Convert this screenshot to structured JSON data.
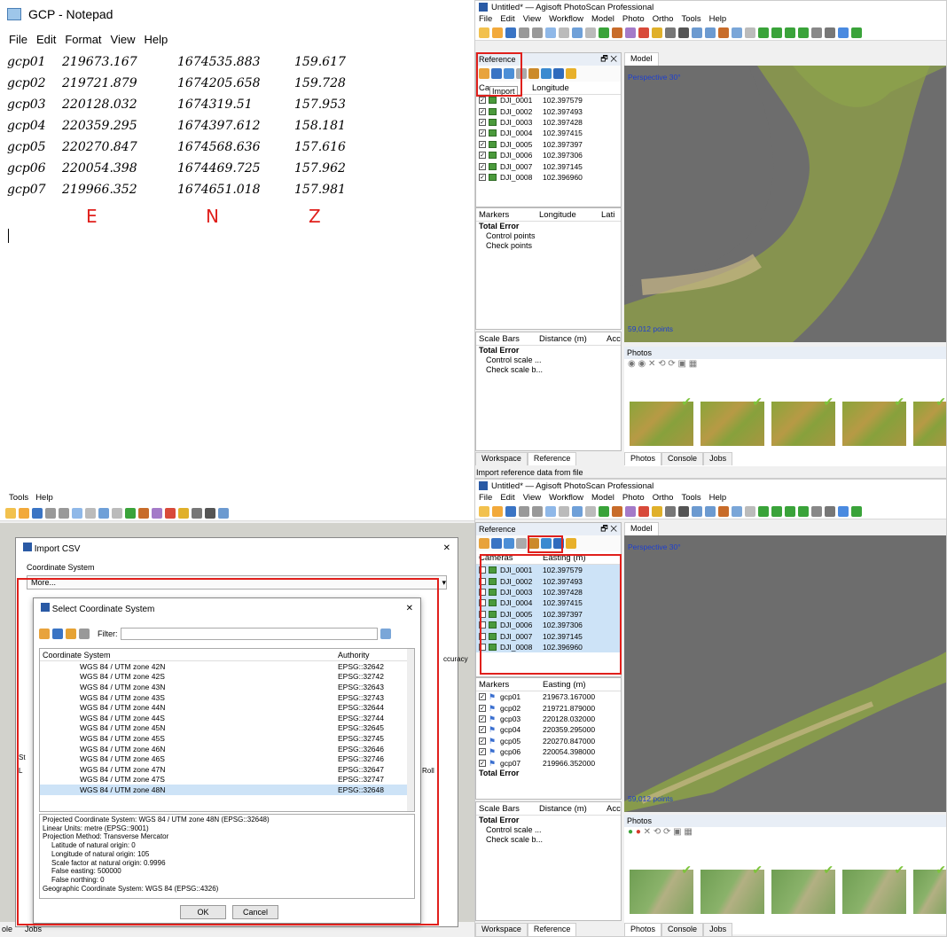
{
  "notepad": {
    "title": "GCP - Notepad",
    "menu": [
      "File",
      "Edit",
      "Format",
      "View",
      "Help"
    ],
    "rows": [
      [
        "gcp01",
        "219673.167",
        "1674535.883",
        "159.617"
      ],
      [
        "gcp02",
        "219721.879",
        "1674205.658",
        "159.728"
      ],
      [
        "gcp03",
        "220128.032",
        "1674319.51",
        "157.953"
      ],
      [
        "gcp04",
        "220359.295",
        "1674397.612",
        "158.181"
      ],
      [
        "gcp05",
        "220270.847",
        "1674568.636",
        "157.616"
      ],
      [
        "gcp06",
        "220054.398",
        "1674469.725",
        "157.962"
      ],
      [
        "gcp07",
        "219966.352",
        "1674651.018",
        "157.981"
      ]
    ],
    "axis_labels": [
      "E",
      "N",
      "Z"
    ]
  },
  "photoscan_top": {
    "title": "Untitled* — Agisoft PhotoScan Professional",
    "menu": [
      "File",
      "Edit",
      "View",
      "Workflow",
      "Model",
      "Photo",
      "Ortho",
      "Tools",
      "Help"
    ],
    "reference_label": "Reference",
    "tooltip": "Import",
    "cameras_col_prefix": "Ca",
    "longitude_col": "Longitude",
    "cameras": [
      [
        "DJI_0001",
        "102.397579"
      ],
      [
        "DJI_0002",
        "102.397493"
      ],
      [
        "DJI_0003",
        "102.397428"
      ],
      [
        "DJI_0004",
        "102.397415"
      ],
      [
        "DJI_0005",
        "102.397397"
      ],
      [
        "DJI_0006",
        "102.397306"
      ],
      [
        "DJI_0007",
        "102.397145"
      ],
      [
        "DJI_0008",
        "102.396960"
      ]
    ],
    "markers_col": "Markers",
    "markers_lon": "Longitude",
    "markers_lat": "Lati",
    "total_error": "Total Error",
    "control_points": "Control points",
    "check_points": "Check points",
    "scalebars_col": "Scale Bars",
    "distance_col": "Distance (m)",
    "acc_col": "Acc",
    "control_scale": "Control scale ...",
    "check_scale": "Check scale b...",
    "model_tab": "Model",
    "perspective": "Perspective 30°",
    "points": "59,012 points",
    "photos_label": "Photos",
    "bottom_tabs_left": [
      "Workspace",
      "Reference"
    ],
    "bottom_tabs_right": [
      "Photos",
      "Console",
      "Jobs"
    ],
    "status": "Import reference data from file"
  },
  "photoscan_bottom": {
    "title": "Untitled* — Agisoft PhotoScan Professional",
    "menu": [
      "File",
      "Edit",
      "View",
      "Workflow",
      "Model",
      "Photo",
      "Ortho",
      "Tools",
      "Help"
    ],
    "reference_label": "Reference",
    "cameras_col": "Cameras",
    "easting_col": "Easting (m)",
    "cameras": [
      [
        "DJI_0001",
        "102.397579"
      ],
      [
        "DJI_0002",
        "102.397493"
      ],
      [
        "DJI_0003",
        "102.397428"
      ],
      [
        "DJI_0004",
        "102.397415"
      ],
      [
        "DJI_0005",
        "102.397397"
      ],
      [
        "DJI_0006",
        "102.397306"
      ],
      [
        "DJI_0007",
        "102.397145"
      ],
      [
        "DJI_0008",
        "102.396960"
      ]
    ],
    "markers_col": "Markers",
    "markers_easting": "Easting (m)",
    "markers": [
      [
        "gcp01",
        "219673.167000"
      ],
      [
        "gcp02",
        "219721.879000"
      ],
      [
        "gcp03",
        "220128.032000"
      ],
      [
        "gcp04",
        "220359.295000"
      ],
      [
        "gcp05",
        "220270.847000"
      ],
      [
        "gcp06",
        "220054.398000"
      ],
      [
        "gcp07",
        "219966.352000"
      ]
    ],
    "total_error": "Total Error",
    "scalebars_col": "Scale Bars",
    "distance_col": "Distance (m)",
    "acc_col": "Acc",
    "control_scale": "Control scale ...",
    "check_scale": "Check scale b...",
    "model_tab": "Model",
    "perspective": "Perspective 30°",
    "points": "59,012 points",
    "photos_label": "Photos",
    "bottom_tabs_left": [
      "Workspace",
      "Reference"
    ],
    "bottom_tabs_right": [
      "Photos",
      "Console",
      "Jobs"
    ]
  },
  "import_csv": {
    "menu": [
      "Tools",
      "Help"
    ],
    "dialog_title": "Import CSV",
    "coord_system_label": "Coordinate System",
    "coord_select_value": "More...",
    "accuracy_fragment": "ccuracy",
    "roll_fragment": "Roll",
    "st_fragment": "St",
    "l_fragment": "L",
    "bottom_tabs": [
      "ole",
      "Jobs"
    ],
    "select_cs": {
      "title": "Select Coordinate System",
      "filter_label": "Filter:",
      "col_cs": "Coordinate System",
      "col_authority": "Authority",
      "rows": [
        [
          "WGS 84 / UTM zone 42N",
          "EPSG::32642"
        ],
        [
          "WGS 84 / UTM zone 42S",
          "EPSG::32742"
        ],
        [
          "WGS 84 / UTM zone 43N",
          "EPSG::32643"
        ],
        [
          "WGS 84 / UTM zone 43S",
          "EPSG::32743"
        ],
        [
          "WGS 84 / UTM zone 44N",
          "EPSG::32644"
        ],
        [
          "WGS 84 / UTM zone 44S",
          "EPSG::32744"
        ],
        [
          "WGS 84 / UTM zone 45N",
          "EPSG::32645"
        ],
        [
          "WGS 84 / UTM zone 45S",
          "EPSG::32745"
        ],
        [
          "WGS 84 / UTM zone 46N",
          "EPSG::32646"
        ],
        [
          "WGS 84 / UTM zone 46S",
          "EPSG::32746"
        ],
        [
          "WGS 84 / UTM zone 47N",
          "EPSG::32647"
        ],
        [
          "WGS 84 / UTM zone 47S",
          "EPSG::32747"
        ],
        [
          "WGS 84 / UTM zone 48N",
          "EPSG::32648"
        ]
      ],
      "details": [
        "Projected Coordinate System: WGS 84 / UTM zone 48N (EPSG::32648)",
        "Linear Units: metre (EPSG::9001)",
        "Projection Method: Transverse Mercator",
        "Latitude of natural origin: 0",
        "Longitude of natural origin: 105",
        "Scale factor at natural origin: 0.9996",
        "False easting: 500000",
        "False northing: 0",
        "Geographic Coordinate System: WGS 84 (EPSG::4326)"
      ],
      "ok": "OK",
      "cancel": "Cancel"
    }
  },
  "colors": {
    "highlight": "#e0201c",
    "selection": "#cde3f7"
  }
}
